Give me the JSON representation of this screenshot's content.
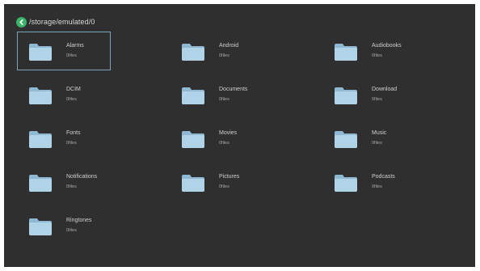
{
  "header": {
    "path": "/storage/emulated/0"
  },
  "folders": [
    {
      "name": "Alarms",
      "count": "0files",
      "selected": true
    },
    {
      "name": "Android",
      "count": "0files"
    },
    {
      "name": "Audiobooks",
      "count": "0files"
    },
    {
      "name": "DCIM",
      "count": "0files"
    },
    {
      "name": "Documents",
      "count": "0files"
    },
    {
      "name": "Download",
      "count": "0files"
    },
    {
      "name": "Fonts",
      "count": "0files"
    },
    {
      "name": "Movies",
      "count": "0files"
    },
    {
      "name": "Music",
      "count": "0files"
    },
    {
      "name": "Notifications",
      "count": "0files"
    },
    {
      "name": "Pictures",
      "count": "0files"
    },
    {
      "name": "Podcasts",
      "count": "0files"
    },
    {
      "name": "Ringtones",
      "count": "0files"
    }
  ],
  "colors": {
    "background": "#2f2f2f",
    "folder": "#a9cde4",
    "back_button": "#3bb26a",
    "selection_border": "#7aa4b8"
  }
}
